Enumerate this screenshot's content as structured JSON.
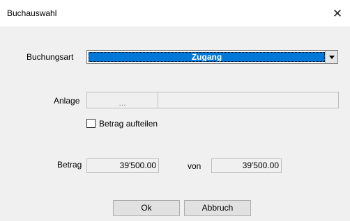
{
  "window": {
    "title": "Buchauswahl",
    "close_glyph": "✕"
  },
  "form": {
    "buchungsart_label": "Buchungsart",
    "buchungsart_value": "Zugang",
    "anlage_label": "Anlage",
    "anlage_button": "...",
    "anlage_value": "",
    "split_label": "Betrag aufteilen",
    "split_checked": false,
    "betrag_label": "Betrag",
    "betrag_value": "39'500.00",
    "von_label": "von",
    "von_value": "39'500.00"
  },
  "buttons": {
    "ok": "Ok",
    "cancel": "Abbruch"
  },
  "colors": {
    "selection": "#0078d7",
    "dialog_bg": "#f0f0f0"
  }
}
